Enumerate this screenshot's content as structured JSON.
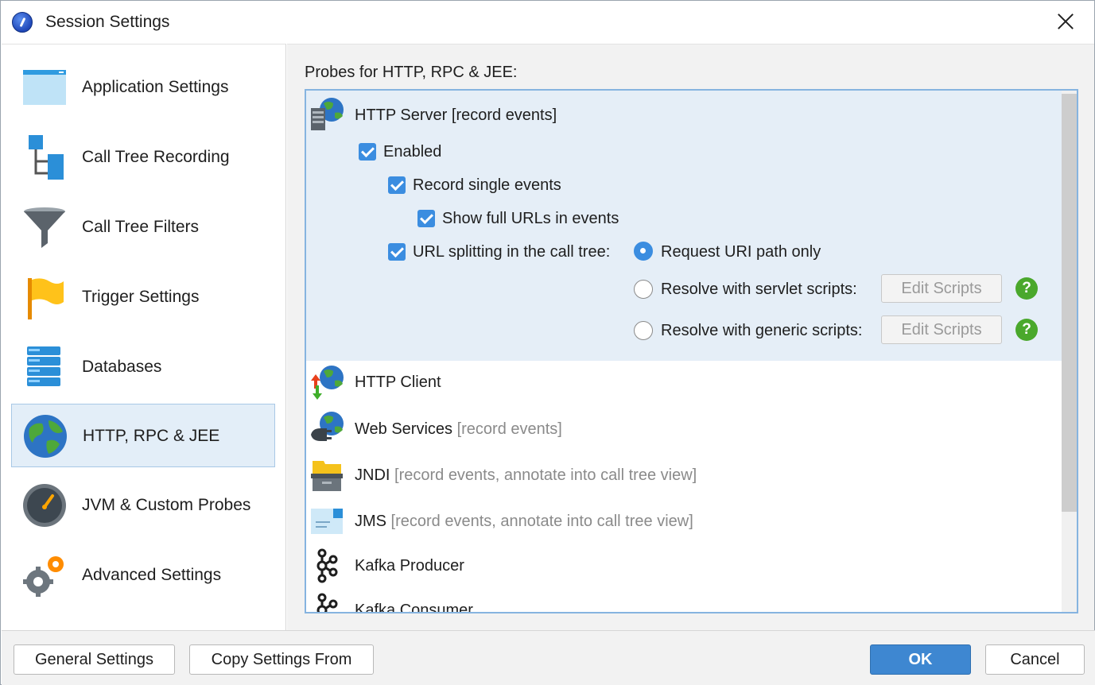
{
  "window": {
    "title": "Session Settings"
  },
  "sidebar": {
    "items": [
      {
        "label": "Application Settings",
        "icon": "window-icon"
      },
      {
        "label": "Call Tree Recording",
        "icon": "call-tree-icon"
      },
      {
        "label": "Call Tree Filters",
        "icon": "funnel-icon"
      },
      {
        "label": "Trigger Settings",
        "icon": "flag-icon"
      },
      {
        "label": "Databases",
        "icon": "database-icon"
      },
      {
        "label": "HTTP, RPC & JEE",
        "icon": "globe-icon",
        "selected": true
      },
      {
        "label": "JVM & Custom Probes",
        "icon": "gauge-icon"
      },
      {
        "label": "Advanced Settings",
        "icon": "gears-icon"
      }
    ]
  },
  "main": {
    "probes_label": "Probes for HTTP, RPC & JEE:",
    "http_server": {
      "title": "HTTP Server",
      "note": " [record events]",
      "enabled_label": "Enabled",
      "record_single_label": "Record single events",
      "show_urls_label": "Show full URLs in events",
      "url_split_label": "URL splitting in the call tree:",
      "radio_request_uri": "Request URI path only",
      "radio_servlet": "Resolve with servlet scripts:",
      "radio_generic": "Resolve with generic scripts:",
      "edit_scripts_label": "Edit Scripts",
      "help_glyph": "?"
    },
    "probes": [
      {
        "title": "HTTP Client",
        "note": ""
      },
      {
        "title": "Web Services",
        "note": " [record events]"
      },
      {
        "title": "JNDI",
        "note": " [record events, annotate into call tree view]"
      },
      {
        "title": "JMS",
        "note": " [record events, annotate into call tree view]"
      },
      {
        "title": "Kafka Producer",
        "note": ""
      },
      {
        "title": "Kafka Consumer",
        "note": ""
      }
    ]
  },
  "footer": {
    "general_settings": "General Settings",
    "copy_settings": "Copy Settings From",
    "ok": "OK",
    "cancel": "Cancel"
  },
  "colors": {
    "accent": "#3b8de0",
    "selection_bg": "#e3eef8",
    "help_green": "#4aa82c"
  }
}
